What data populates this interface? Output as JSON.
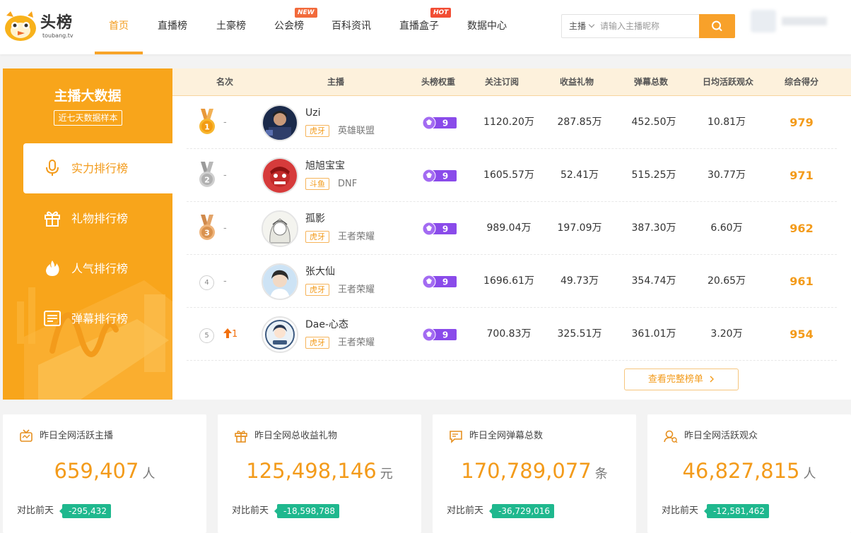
{
  "header": {
    "logo_text": "头榜",
    "logo_sub": "toubang.tv",
    "nav": [
      {
        "label": "首页",
        "active": true
      },
      {
        "label": "直播榜"
      },
      {
        "label": "土豪榜"
      },
      {
        "label": "公会榜",
        "tag": "NEW"
      },
      {
        "label": "百科资讯"
      },
      {
        "label": "直播盒子",
        "tag": "HOT"
      },
      {
        "label": "数据中心"
      }
    ],
    "search": {
      "type": "主播",
      "placeholder": "请输入主播昵称"
    }
  },
  "sidebar": {
    "title": "主播大数据",
    "subtitle": "近七天数据样本",
    "items": [
      {
        "label": "实力排行榜",
        "icon": "microphone-icon",
        "active": true
      },
      {
        "label": "礼物排行榜",
        "icon": "gift-icon"
      },
      {
        "label": "人气排行榜",
        "icon": "fire-icon"
      },
      {
        "label": "弹幕排行榜",
        "icon": "danmaku-icon"
      }
    ]
  },
  "table": {
    "headers": [
      "名次",
      "主播",
      "头榜权重",
      "关注订阅",
      "收益礼物",
      "弹幕总数",
      "日均活跃观众",
      "综合得分"
    ],
    "rows": [
      {
        "rank": "1",
        "trend": "-",
        "name": "Uzi",
        "platform": "虎牙",
        "game": "英雄联盟",
        "weight": "9",
        "follows": "1120.20万",
        "gifts": "287.85万",
        "danmaku": "452.50万",
        "viewers": "10.81万",
        "score": "979"
      },
      {
        "rank": "2",
        "trend": "-",
        "name": "旭旭宝宝",
        "platform": "斗鱼",
        "game": "DNF",
        "weight": "9",
        "follows": "1605.57万",
        "gifts": "52.41万",
        "danmaku": "515.25万",
        "viewers": "30.77万",
        "score": "971"
      },
      {
        "rank": "3",
        "trend": "-",
        "name": "孤影",
        "platform": "虎牙",
        "game": "王者荣耀",
        "weight": "9",
        "follows": "989.04万",
        "gifts": "197.09万",
        "danmaku": "387.30万",
        "viewers": "6.60万",
        "score": "962"
      },
      {
        "rank": "4",
        "trend": "-",
        "name": "张大仙",
        "platform": "虎牙",
        "game": "王者荣耀",
        "weight": "9",
        "follows": "1696.61万",
        "gifts": "49.73万",
        "danmaku": "354.74万",
        "viewers": "20.65万",
        "score": "961"
      },
      {
        "rank": "5",
        "trend": "1",
        "name": "Dae-心态",
        "platform": "虎牙",
        "game": "王者荣耀",
        "weight": "9",
        "follows": "700.83万",
        "gifts": "325.51万",
        "danmaku": "361.01万",
        "viewers": "3.20万",
        "score": "954"
      }
    ],
    "more_label": "查看完整榜单"
  },
  "stats": [
    {
      "label": "昨日全网活跃主播",
      "value": "659,407",
      "unit": "人",
      "cmp_label": "对比前天",
      "delta": "-295,432",
      "icon": "live-tv-icon"
    },
    {
      "label": "昨日全网总收益礼物",
      "value": "125,498,146",
      "unit": "元",
      "cmp_label": "对比前天",
      "delta": "-18,598,788",
      "icon": "gift-box-icon"
    },
    {
      "label": "昨日全网弹幕总数",
      "value": "170,789,077",
      "unit": "条",
      "cmp_label": "对比前天",
      "delta": "-36,729,016",
      "icon": "comment-edit-icon"
    },
    {
      "label": "昨日全网活跃观众",
      "value": "46,827,815",
      "unit": "人",
      "cmp_label": "对比前天",
      "delta": "-12,581,462",
      "icon": "audience-icon"
    }
  ],
  "colors": {
    "accent": "#f8a51b",
    "score": "#f39b1b",
    "delta_bg": "#1fb88e",
    "badge": "#8a4bea"
  }
}
